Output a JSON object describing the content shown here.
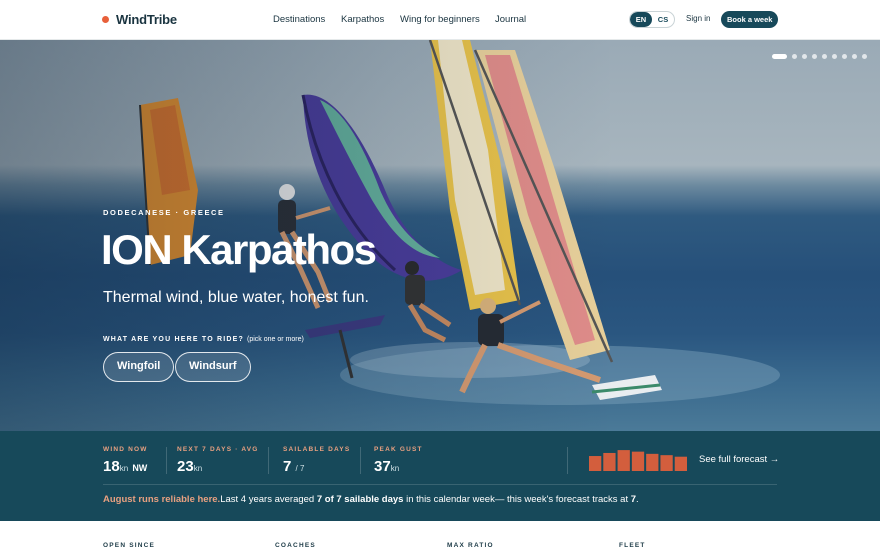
{
  "brand": {
    "name": "WindTribe",
    "dot_color": "#e8603a"
  },
  "nav": {
    "links": [
      "Destinations",
      "Karpathos",
      "Wing for beginners",
      "Journal"
    ],
    "lang": [
      "EN",
      "CS"
    ],
    "lang_active": "EN",
    "sign_in": "Sign in",
    "book": "Book a week"
  },
  "hero": {
    "eyebrow": "DODECANESE · GREECE",
    "title": "ION Karpathos",
    "subtitle": "Thermal wind, blue water, honest fun.",
    "question": "WHAT ARE YOU HERE TO RIDE?",
    "question_hint": "(pick one or more)",
    "chips": [
      "Wingfoil",
      "Windsurf"
    ],
    "carousel": {
      "count": 9,
      "active_index": 0
    }
  },
  "stats": {
    "wind_now": {
      "label": "WIND NOW",
      "value": "18",
      "unit": "kn",
      "dir": "NW"
    },
    "next7": {
      "label": "NEXT 7 DAYS · AVG",
      "value": "23",
      "unit": "kn"
    },
    "sailable": {
      "label": "SAILABLE DAYS",
      "value": "7",
      "unit": "/ 7"
    },
    "peak": {
      "label": "PEAK GUST",
      "value": "37",
      "unit": "kn"
    },
    "forecast_bars": [
      0.68,
      0.82,
      0.95,
      0.88,
      0.78,
      0.72,
      0.65
    ],
    "forecast_link": "See full forecast →",
    "note": {
      "highlight": "August runs reliable here.",
      "p1": "Last 4 years averaged ",
      "b1": "7 of 7 sailable days",
      "p2": " in this calendar week— this week's forecast tracks at ",
      "b2": "7",
      "p3": "."
    }
  },
  "facts": [
    "OPEN SINCE",
    "COACHES",
    "MAX RATIO",
    "FLEET"
  ],
  "colors": {
    "accent": "#e8603a",
    "teal": "#17495a",
    "label_peach": "#e8a080"
  }
}
